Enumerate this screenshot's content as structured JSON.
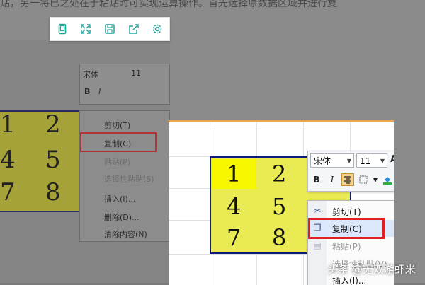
{
  "background": {
    "article_text": "贴，另一将已之处在于粘贴时可实现运算操作。首先选择原数据区域并进行复",
    "numbers": [
      "1",
      "2",
      "4",
      "5",
      "7",
      "8"
    ],
    "mini_toolbar": {
      "font": "宋体",
      "size": "11"
    },
    "menu_items": [
      "剪切(T)",
      "复制(C)",
      "粘贴(P)",
      "选择性粘贴(S)",
      "插入(I)...",
      "删除(D)...",
      "清除内容(N)"
    ]
  },
  "floating_toolbar": {
    "icons": [
      "tablet-icon",
      "expand-icon",
      "save-icon",
      "share-icon",
      "settings-icon"
    ]
  },
  "sheet": {
    "numbers": [
      "1",
      "2",
      "4",
      "5",
      "7",
      "8"
    ]
  },
  "mini_toolbar": {
    "font": "宋体",
    "size": "11",
    "font_a": "A",
    "bold": "B",
    "italic": "I"
  },
  "context_menu": {
    "cut": "剪切(T)",
    "copy": "复制(C)",
    "paste": "粘贴(P)",
    "paste_special": "选择性粘贴(V)...",
    "insert": "插入(I)..."
  },
  "watermark": "头条 @无双游虾米",
  "colors": {
    "accent_orange": "#f0a64a",
    "cell_yellow": "#f7f700",
    "cell_fill": "#eaea55",
    "selection_border": "#0b1d7a",
    "highlight_red": "#e02020"
  }
}
